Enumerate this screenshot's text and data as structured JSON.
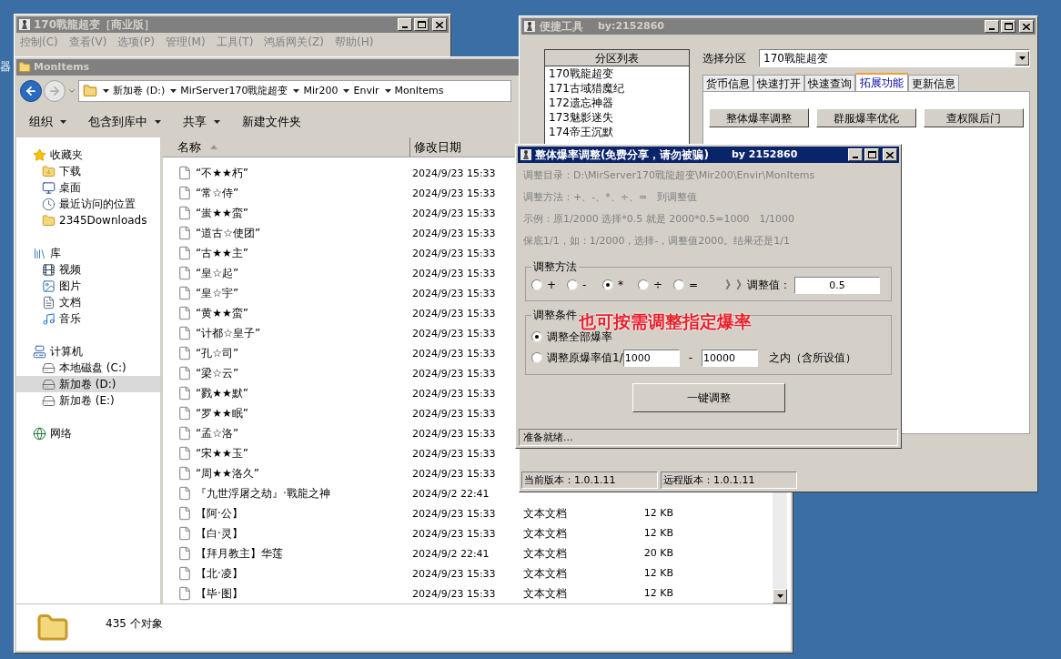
{
  "desktop": {
    "icon_label": "器"
  },
  "server_window": {
    "title": "170戰龍超变［商业版］",
    "menu": [
      "控制(C)",
      "查看(V)",
      "选项(P)",
      "管理(M)",
      "工具(T)",
      "鸿盾网关(Z)",
      "帮助(H)"
    ]
  },
  "explorer": {
    "title": "MonItems",
    "breadcrumb": [
      "新加卷 (D:)",
      "MirServer170戰龍超变",
      "Mir200",
      "Envir",
      "MonItems"
    ],
    "toolbar": [
      {
        "label": "组织",
        "dropdown": true
      },
      {
        "label": "包含到库中",
        "dropdown": true
      },
      {
        "label": "共享",
        "dropdown": true
      },
      {
        "label": "新建文件夹",
        "dropdown": false
      }
    ],
    "nav": [
      {
        "label": "收藏夹",
        "kind": "star",
        "selected": false,
        "children": [
          {
            "label": "下载",
            "kind": "download",
            "selected": false
          },
          {
            "label": "桌面",
            "kind": "desktop",
            "selected": false
          },
          {
            "label": "最近访问的位置",
            "kind": "recent",
            "selected": false
          },
          {
            "label": "2345Downloads",
            "kind": "folder",
            "selected": false
          }
        ]
      },
      {
        "label": "库",
        "kind": "library",
        "selected": false,
        "children": [
          {
            "label": "视频",
            "kind": "video",
            "selected": false
          },
          {
            "label": "图片",
            "kind": "picture",
            "selected": false
          },
          {
            "label": "文档",
            "kind": "document",
            "selected": false
          },
          {
            "label": "音乐",
            "kind": "music",
            "selected": false
          }
        ]
      },
      {
        "label": "计算机",
        "kind": "computer",
        "selected": false,
        "children": [
          {
            "label": "本地磁盘 (C:)",
            "kind": "drive",
            "selected": false
          },
          {
            "label": "新加卷 (D:)",
            "kind": "drive",
            "selected": true
          },
          {
            "label": "新加卷 (E:)",
            "kind": "drive",
            "selected": false
          }
        ]
      },
      {
        "label": "网络",
        "kind": "network",
        "selected": false
      }
    ],
    "columns": [
      "名称",
      "修改日期"
    ],
    "rows": [
      {
        "name": "“不★★朽”",
        "date": "2024/9/23 15:33"
      },
      {
        "name": "“常☆侍”",
        "date": "2024/9/23 15:33"
      },
      {
        "name": "“蚩★★蛮”",
        "date": "2024/9/23 15:33"
      },
      {
        "name": "“道古☆使团”",
        "date": "2024/9/23 15:33"
      },
      {
        "name": "“古★★主”",
        "date": "2024/9/23 15:33"
      },
      {
        "name": "“皇☆起”",
        "date": "2024/9/23 15:33"
      },
      {
        "name": "“皇☆宇”",
        "date": "2024/9/23 15:33"
      },
      {
        "name": "“黄★★蛮”",
        "date": "2024/9/23 15:33"
      },
      {
        "name": "“计都☆皇子”",
        "date": "2024/9/23 15:33"
      },
      {
        "name": "“孔☆司”",
        "date": "2024/9/23 15:33"
      },
      {
        "name": "“梁☆云”",
        "date": "2024/9/23 15:33"
      },
      {
        "name": "“戮★★默”",
        "date": "2024/9/23 15:33"
      },
      {
        "name": "“罗★★眠”",
        "date": "2024/9/23 15:33"
      },
      {
        "name": "“孟☆洛”",
        "date": "2024/9/23 15:33"
      },
      {
        "name": "“宋★★玉”",
        "date": "2024/9/23 15:33"
      },
      {
        "name": "“周★★洛久”",
        "date": "2024/9/23 15:33"
      },
      {
        "name": "『九世浮屠之劫』·戰龍之神",
        "date": "2024/9/2 22:41"
      },
      {
        "name": "【阿·公】",
        "date": "2024/9/23 15:33",
        "type": "文本文档",
        "size": "12 KB"
      },
      {
        "name": "【白·灵】",
        "date": "2024/9/23 15:33",
        "type": "文本文档",
        "size": "12 KB"
      },
      {
        "name": "【拜月教主】华莲",
        "date": "2024/9/2 22:41",
        "type": "文本文档",
        "size": "20 KB"
      },
      {
        "name": "【北·凌】",
        "date": "2024/9/23 15:33",
        "type": "文本文档",
        "size": "12 KB"
      },
      {
        "name": "【毕·图】",
        "date": "2024/9/23 15:33",
        "type": "文本文档",
        "size": "12 KB"
      }
    ],
    "status": "435 个对象"
  },
  "tool_window": {
    "title": "便捷工具",
    "author": "by:2152860",
    "partition_list": {
      "header": "分区列表",
      "items": [
        "170戰龍超变",
        "171古域猎魔纪",
        "172遗忘神器",
        "173魅影迷失",
        "174帝王沉默"
      ]
    },
    "select_label": "选择分区",
    "select_value": "170戰龍超变",
    "tabs": [
      {
        "label": "货币信息",
        "selected": false
      },
      {
        "label": "快速打开",
        "selected": false
      },
      {
        "label": "快速查询",
        "selected": false
      },
      {
        "label": "拓展功能",
        "selected": true
      },
      {
        "label": "更新信息",
        "selected": false
      }
    ],
    "buttons": [
      "整体爆率调整",
      "群服爆率优化",
      "查权限后门"
    ],
    "status": [
      "当前版本：1.0.1.11",
      "远程版本：1.0.1.11"
    ]
  },
  "dialog": {
    "title": "整体爆率调整(免费分享，请勿被骗)",
    "author": "by 2152860",
    "info": [
      "调整目录：D:\\MirServer170戰龍超变\\Mir200\\Envir\\MonItems",
      "调整方法：+、-、*、÷、=　到调整值",
      "示例：原1/2000 选择*0.5 就是 2000*0.5=1000　1/1000",
      "保底1/1，如：1/2000，选择-，调整值2000。结果还是1/1"
    ],
    "method": {
      "title": "调整方法",
      "options": [
        {
          "label": "+",
          "selected": false
        },
        {
          "label": "-",
          "selected": false
        },
        {
          "label": "*",
          "selected": true
        },
        {
          "label": "÷",
          "selected": false
        },
        {
          "label": "=",
          "selected": false
        }
      ],
      "value_label": "》》调整值：",
      "value": "0.5"
    },
    "condition": {
      "title": "调整条件",
      "annotation": "也可按需调整指定爆率",
      "options": [
        {
          "label": "调整全部爆率",
          "selected": true
        },
        {
          "label": "调整原爆率值1/",
          "selected": false
        }
      ],
      "range_from": "1000",
      "range_separator": "-",
      "range_to": "10000",
      "range_suffix": "之内（含所设值）"
    },
    "button": "一键调整",
    "status": "准备就绪..."
  }
}
